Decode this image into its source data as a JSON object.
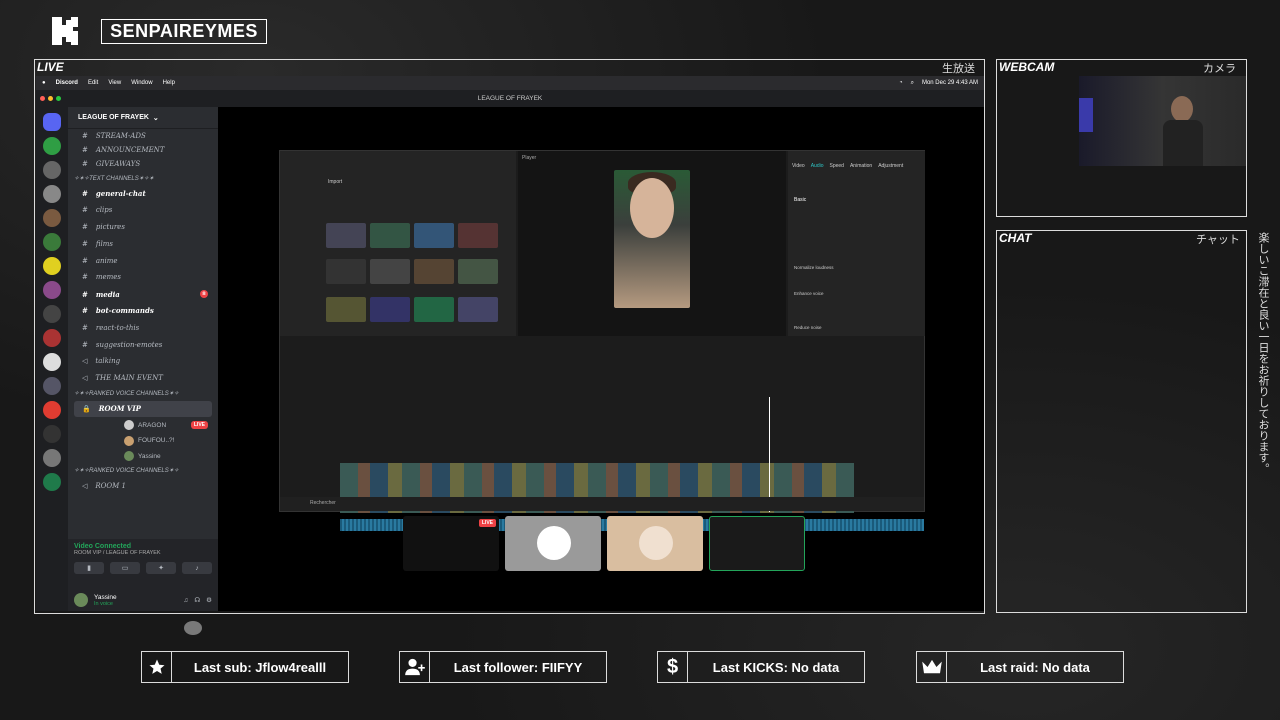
{
  "overlay": {
    "channel": "SENPAIREYMES",
    "live_label": "LIVE",
    "live_jp": "生放送",
    "webcam_label": "WEBCAM",
    "webcam_jp": "カメラ",
    "chat_label": "CHAT",
    "chat_jp": "チャット",
    "side_jp": "楽しいこ滞在と良い一日をお祈りしております。",
    "stats": {
      "sub": "Last sub: Jflow4realll",
      "follower": "Last follower: FIIFYY",
      "kicks": "Last KICKS: No data",
      "raid": "Last raid: No data"
    }
  },
  "macbar": {
    "app": "Discord",
    "menus": [
      "Edit",
      "View",
      "Window",
      "Help"
    ],
    "clock": "Mon Dec 29  4:43 AM"
  },
  "discord": {
    "window_title": "LEAGUE OF FRAYEK",
    "server": "LEAGUE OF FRAYEK",
    "top_channels": [
      "STREAM-ADS",
      "ANNOUNCEMENT",
      "GIVEAWAYS"
    ],
    "text_category": "✧✶✧TEXT CHANNELS✶✧✶",
    "text_channels": [
      {
        "name": "general-chat",
        "bold": true
      },
      {
        "name": "clips",
        "bold": false
      },
      {
        "name": "pictures",
        "bold": false
      },
      {
        "name": "films",
        "bold": false
      },
      {
        "name": "anime",
        "bold": false
      },
      {
        "name": "memes",
        "bold": false
      },
      {
        "name": "media",
        "bold": true,
        "badge": "8"
      },
      {
        "name": "bot-commands",
        "bold": true
      },
      {
        "name": "react-to-this",
        "bold": false
      },
      {
        "name": "suggestion-emotes",
        "bold": false
      },
      {
        "name": "talking",
        "bold": false
      },
      {
        "name": "THE MAIN EVENT",
        "bold": false
      }
    ],
    "voice_category": "✧✶✧RANKED VOICE CHANNELS✶✧",
    "voice_room": "ROOM VIP",
    "members": [
      {
        "name": "ARAGON",
        "live": "LIVE"
      },
      {
        "name": "FOUFOU..?!",
        "live": ""
      },
      {
        "name": "Yassine",
        "live": ""
      }
    ],
    "voice_category_2": "✧✶✧RANKED VOICE CHANNELS✶✧",
    "voice_room_2": "ROOM 1",
    "connection": "Video Connected",
    "connection_sub": "ROOM VIP / LEAGUE OF FRAYEK",
    "user": "Yassine",
    "user_status": "In voice"
  },
  "editor": {
    "import_label": "Import",
    "player_label": "Player",
    "tabs": [
      "Video",
      "Audio",
      "Speed",
      "Animation",
      "Adjustment"
    ],
    "basic_label": "Basic",
    "normalize": "Normalize loudness",
    "enhance": "Enhance voice",
    "reduce": "Reduce noise",
    "search": "Rechercher"
  },
  "colors": {
    "discord_green": "#23a55a",
    "discord_red": "#ed4245",
    "overlay_border": "#dcdcdc"
  }
}
